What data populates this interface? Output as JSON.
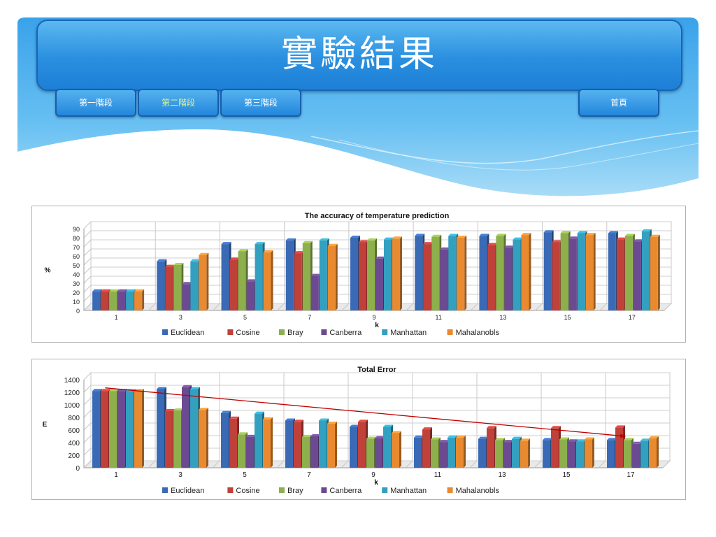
{
  "header": {
    "title": "實驗結果",
    "nav": [
      {
        "label": "第一階段",
        "active": false
      },
      {
        "label": "第二階段",
        "active": true
      },
      {
        "label": "第三階段",
        "active": false
      },
      {
        "label": "首頁",
        "active": false
      }
    ]
  },
  "colors": {
    "title_bar": "#2a8fe0",
    "active_nav_text": "#d8f39a",
    "trend_arrow": "#c00000"
  },
  "chart_data": [
    {
      "type": "bar",
      "title": "The accuracy of temperature prediction",
      "xlabel": "k",
      "ylabel": "%",
      "ylim": [
        0,
        90
      ],
      "yticks": [
        0,
        10,
        20,
        30,
        40,
        50,
        60,
        70,
        80,
        90
      ],
      "categories": [
        "1",
        "3",
        "5",
        "7",
        "9",
        "11",
        "13",
        "15",
        "17"
      ],
      "grid": true,
      "legend": "bottom",
      "series": [
        {
          "name": "Euclidean",
          "color": "#3a6ab5",
          "values": [
            21,
            54,
            73,
            77,
            80,
            82,
            82,
            86,
            85
          ]
        },
        {
          "name": "Cosine",
          "color": "#c0403a",
          "values": [
            21,
            48,
            56,
            63,
            75,
            73,
            72,
            75,
            78
          ]
        },
        {
          "name": "Bray",
          "color": "#8db04c",
          "values": [
            21,
            50,
            65,
            74,
            77,
            81,
            82,
            85,
            82
          ]
        },
        {
          "name": "Canberra",
          "color": "#6c4a91",
          "values": [
            21,
            29,
            32,
            38,
            57,
            67,
            69,
            79,
            76
          ]
        },
        {
          "name": "Manhattan",
          "color": "#33a0c0",
          "values": [
            21,
            54,
            73,
            77,
            78,
            82,
            78,
            85,
            87
          ]
        },
        {
          "name": "Mahalanobls",
          "color": "#e98a30",
          "values": [
            21,
            61,
            64,
            71,
            79,
            80,
            83,
            83,
            81
          ]
        }
      ]
    },
    {
      "type": "bar",
      "title": "Total Error",
      "xlabel": "k",
      "ylabel": "E",
      "ylim": [
        0,
        1400
      ],
      "yticks": [
        0,
        200,
        400,
        600,
        800,
        1000,
        1200,
        1400
      ],
      "categories": [
        "1",
        "3",
        "5",
        "7",
        "9",
        "11",
        "13",
        "15",
        "17"
      ],
      "grid": true,
      "legend": "bottom",
      "trend_arrow": {
        "from_category": "1",
        "from_value": 1270,
        "to_category": "17",
        "to_value": 500
      },
      "series": [
        {
          "name": "Euclidean",
          "color": "#3a6ab5",
          "values": [
            1220,
            1250,
            870,
            750,
            650,
            480,
            460,
            440,
            440
          ]
        },
        {
          "name": "Cosine",
          "color": "#c0403a",
          "values": [
            1220,
            900,
            780,
            730,
            730,
            610,
            630,
            630,
            640
          ]
        },
        {
          "name": "Bray",
          "color": "#8db04c",
          "values": [
            1220,
            910,
            530,
            490,
            460,
            450,
            440,
            450,
            440
          ]
        },
        {
          "name": "Canberra",
          "color": "#6c4a91",
          "values": [
            1220,
            1280,
            490,
            500,
            470,
            410,
            410,
            420,
            380
          ]
        },
        {
          "name": "Manhattan",
          "color": "#33a0c0",
          "values": [
            1220,
            1250,
            860,
            750,
            650,
            480,
            460,
            420,
            430
          ]
        },
        {
          "name": "Mahalanobls",
          "color": "#e98a30",
          "values": [
            1220,
            920,
            770,
            700,
            550,
            480,
            430,
            450,
            470
          ]
        }
      ]
    }
  ]
}
